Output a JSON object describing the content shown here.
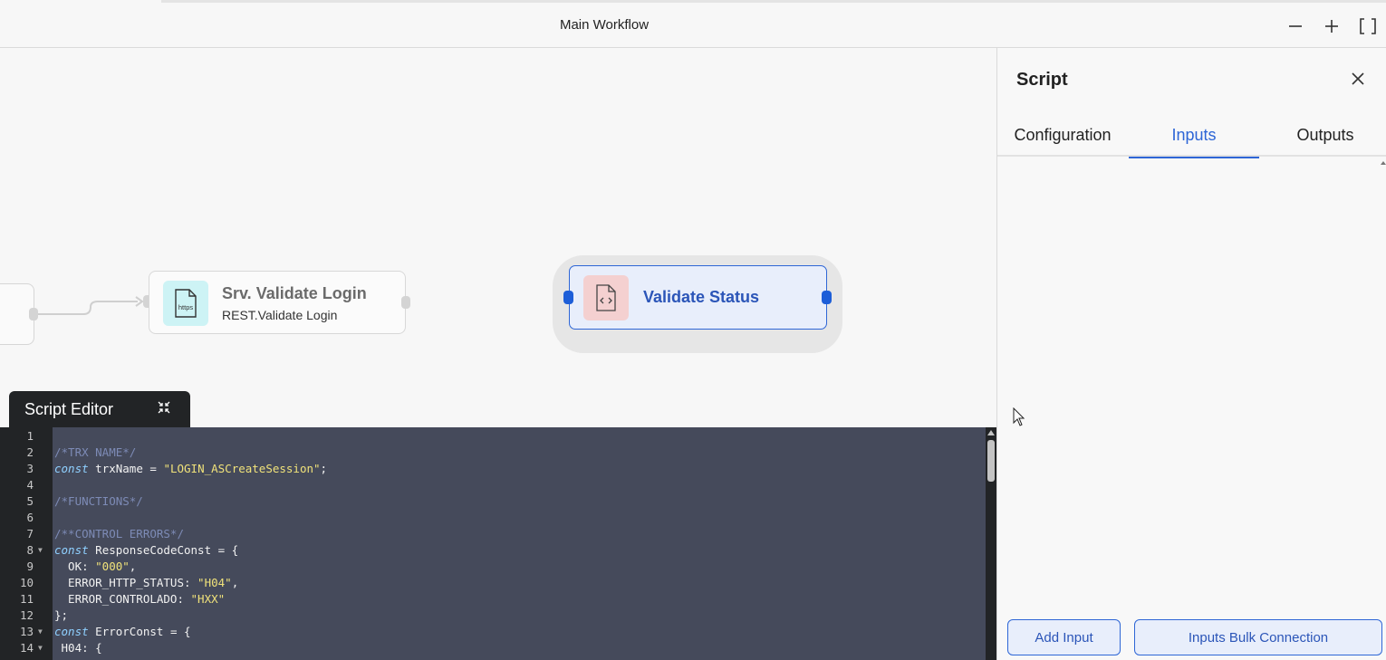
{
  "window": {
    "title": "Main Workflow"
  },
  "canvas": {
    "nodes": [
      {
        "title": "Srv. Validate Login",
        "subtitle": "REST.Validate Login",
        "icon": "https-file-icon",
        "icon_label": "https"
      },
      {
        "title": "Validate Status",
        "icon": "code-file-icon"
      }
    ]
  },
  "editor": {
    "tab_label": "Script Editor",
    "lines": [
      {
        "n": "1",
        "fold": false,
        "tokens": []
      },
      {
        "n": "2",
        "fold": false,
        "tokens": [
          {
            "t": "comment",
            "v": "/*TRX NAME*/"
          }
        ]
      },
      {
        "n": "3",
        "fold": false,
        "tokens": [
          {
            "t": "kw",
            "v": "const"
          },
          {
            "t": "var",
            "v": " trxName = "
          },
          {
            "t": "str",
            "v": "\"LOGIN_ASCreateSession\""
          },
          {
            "t": "var",
            "v": ";"
          }
        ]
      },
      {
        "n": "4",
        "fold": false,
        "tokens": []
      },
      {
        "n": "5",
        "fold": false,
        "tokens": [
          {
            "t": "comment",
            "v": "/*FUNCTIONS*/"
          }
        ]
      },
      {
        "n": "6",
        "fold": false,
        "tokens": []
      },
      {
        "n": "7",
        "fold": false,
        "tokens": [
          {
            "t": "comment",
            "v": "/**CONTROL ERRORS*/"
          }
        ]
      },
      {
        "n": "8",
        "fold": true,
        "tokens": [
          {
            "t": "kw",
            "v": "const"
          },
          {
            "t": "var",
            "v": " ResponseCodeConst = {"
          }
        ]
      },
      {
        "n": "9",
        "fold": false,
        "tokens": [
          {
            "t": "var",
            "v": "  OK: "
          },
          {
            "t": "str",
            "v": "\"000\""
          },
          {
            "t": "var",
            "v": ","
          }
        ]
      },
      {
        "n": "10",
        "fold": false,
        "tokens": [
          {
            "t": "var",
            "v": "  ERROR_HTTP_STATUS: "
          },
          {
            "t": "str",
            "v": "\"H04\""
          },
          {
            "t": "var",
            "v": ","
          }
        ]
      },
      {
        "n": "11",
        "fold": false,
        "tokens": [
          {
            "t": "var",
            "v": "  ERROR_CONTROLADO: "
          },
          {
            "t": "str",
            "v": "\"HXX\""
          }
        ]
      },
      {
        "n": "12",
        "fold": false,
        "tokens": [
          {
            "t": "var",
            "v": "};"
          }
        ]
      },
      {
        "n": "13",
        "fold": true,
        "tokens": [
          {
            "t": "kw",
            "v": "const"
          },
          {
            "t": "var",
            "v": " ErrorConst = {"
          }
        ]
      },
      {
        "n": "14",
        "fold": true,
        "tokens": [
          {
            "t": "var",
            "v": " H04: {"
          }
        ]
      }
    ]
  },
  "panel": {
    "title": "Script",
    "tabs": [
      {
        "label": "Configuration",
        "active": false
      },
      {
        "label": "Inputs",
        "active": true
      },
      {
        "label": "Outputs",
        "active": false
      }
    ],
    "buttons": {
      "add_input": "Add Input",
      "bulk": "Inputs Bulk Connection"
    }
  },
  "colors": {
    "accent": "#2e66d6",
    "selected_node_bg": "#e8eefb",
    "editor_bg": "#454a5b"
  }
}
